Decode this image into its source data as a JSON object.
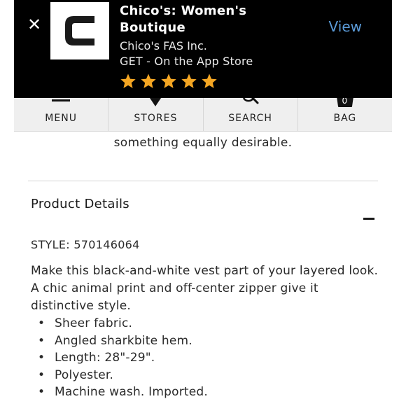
{
  "banner": {
    "close_icon": "close-icon",
    "logo_letter": "C",
    "title": "Chico's: Women's Boutique",
    "company": "Chico's FAS Inc.",
    "get_text": "GET - On the App Store",
    "rating_stars": 5,
    "star_color": "#f4a623",
    "view_label": "View",
    "view_color": "#5b9bd8"
  },
  "nav": {
    "items": [
      {
        "label": "MENU",
        "icon": "menu-icon"
      },
      {
        "label": "STORES",
        "icon": "location-pin-icon"
      },
      {
        "label": "SEARCH",
        "icon": "search-icon"
      },
      {
        "label": "BAG",
        "icon": "bag-icon",
        "count": "0"
      }
    ]
  },
  "content": {
    "intro_tail": "something equally desirable.",
    "section_heading": "Product Details",
    "collapse_icon": "minus-icon",
    "style_label": "STYLE:",
    "style_number": "570146064",
    "description": "Make this black-and-white vest part of your layered look. A chic animal print and off-center zipper give it distinctive style.",
    "bullets": [
      "Sheer fabric.",
      "Angled sharkbite hem.",
      "Length: 28\"-29\".",
      "Polyester.",
      "Machine wash. Imported."
    ]
  }
}
